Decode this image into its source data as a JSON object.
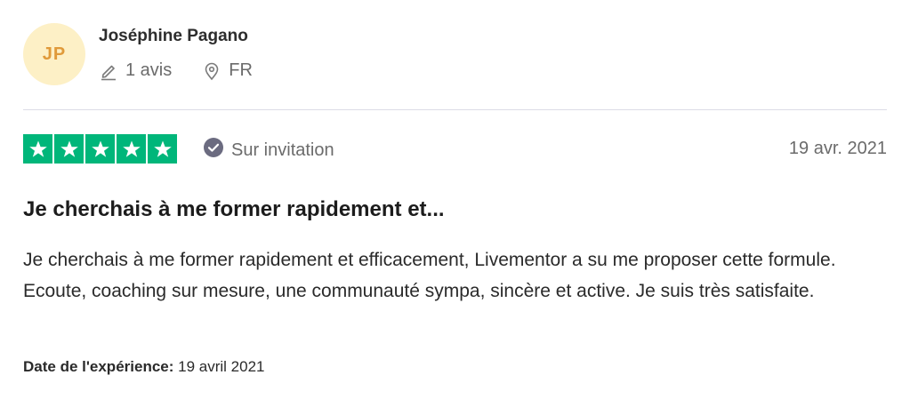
{
  "reviewer": {
    "initials": "JP",
    "name": "Joséphine Pagano",
    "reviews_count": "1 avis",
    "country": "FR",
    "avatar_bg": "#fdf0c6",
    "avatar_fg": "#e09a3a"
  },
  "review": {
    "rating": 5,
    "rating_max": 5,
    "star_color": "#00b67a",
    "invitation_label": "Sur invitation",
    "date": "19 avr. 2021",
    "title": "Je cherchais à me former rapidement et...",
    "body": "Je cherchais à me former rapidement et efficacement, Livementor a su me proposer cette formule. Ecoute, coaching sur mesure, une communauté sympa, sincère et active. Je suis très satisfaite.",
    "experience_label": "Date de l'expérience:",
    "experience_date": "19 avril 2021"
  },
  "icons": [
    "pencil-icon",
    "location-pin-icon",
    "star-icon",
    "verified-check-icon"
  ]
}
